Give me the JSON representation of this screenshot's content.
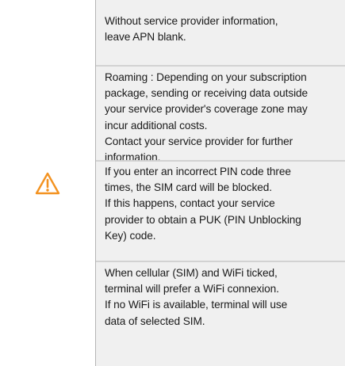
{
  "icon": {
    "name": "warning-triangle-icon",
    "color": "#f39220"
  },
  "notes": [
    {
      "text": "Without service provider information,\nleave APN blank."
    },
    {
      "text": "Roaming : Depending on your subscription\npackage, sending or receiving data outside\nyour service provider's coverage zone may\nincur additional costs.\nContact your service provider for further\ninformation."
    },
    {
      "text": "If you enter an incorrect PIN code three\ntimes, the SIM card will be blocked.\nIf this happens, contact your service\nprovider to obtain a PUK (PIN Unblocking\nKey) code."
    },
    {
      "text": "When cellular (SIM) and WiFi ticked,\nterminal will prefer a WiFi connexion.\nIf no WiFi is available, terminal will use\ndata of selected SIM."
    }
  ]
}
